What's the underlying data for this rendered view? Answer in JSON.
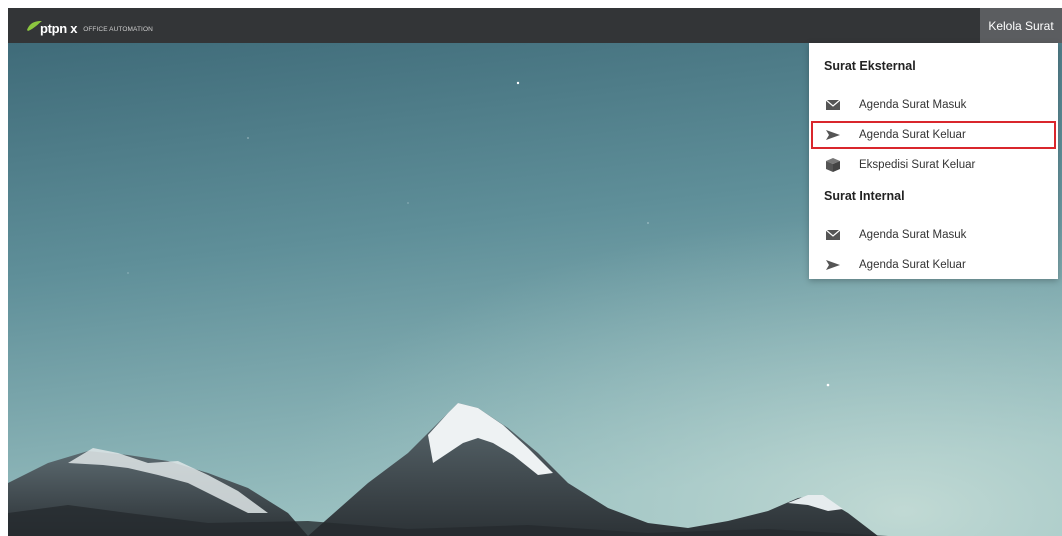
{
  "header": {
    "brand_name": "ptpn x",
    "brand_subtitle": "OFFICE AUTOMATION",
    "nav_button": "Kelola Surat"
  },
  "dropdown": {
    "sections": [
      {
        "title": "Surat Eksternal",
        "items": [
          {
            "label": "Agenda Surat Masuk",
            "icon": "envelope-icon"
          },
          {
            "label": "Agenda Surat Keluar",
            "icon": "send-icon",
            "highlighted": true
          },
          {
            "label": "Ekspedisi Surat Keluar",
            "icon": "box-icon"
          }
        ]
      },
      {
        "title": "Surat Internal",
        "items": [
          {
            "label": "Agenda Surat Masuk",
            "icon": "envelope-icon"
          },
          {
            "label": "Agenda Surat Keluar",
            "icon": "send-icon"
          }
        ]
      }
    ]
  },
  "colors": {
    "topbar": "#333537",
    "nav_button_bg": "#5b5d60",
    "highlight_border": "#d9262c",
    "brand_leaf": "#8cc63f"
  }
}
